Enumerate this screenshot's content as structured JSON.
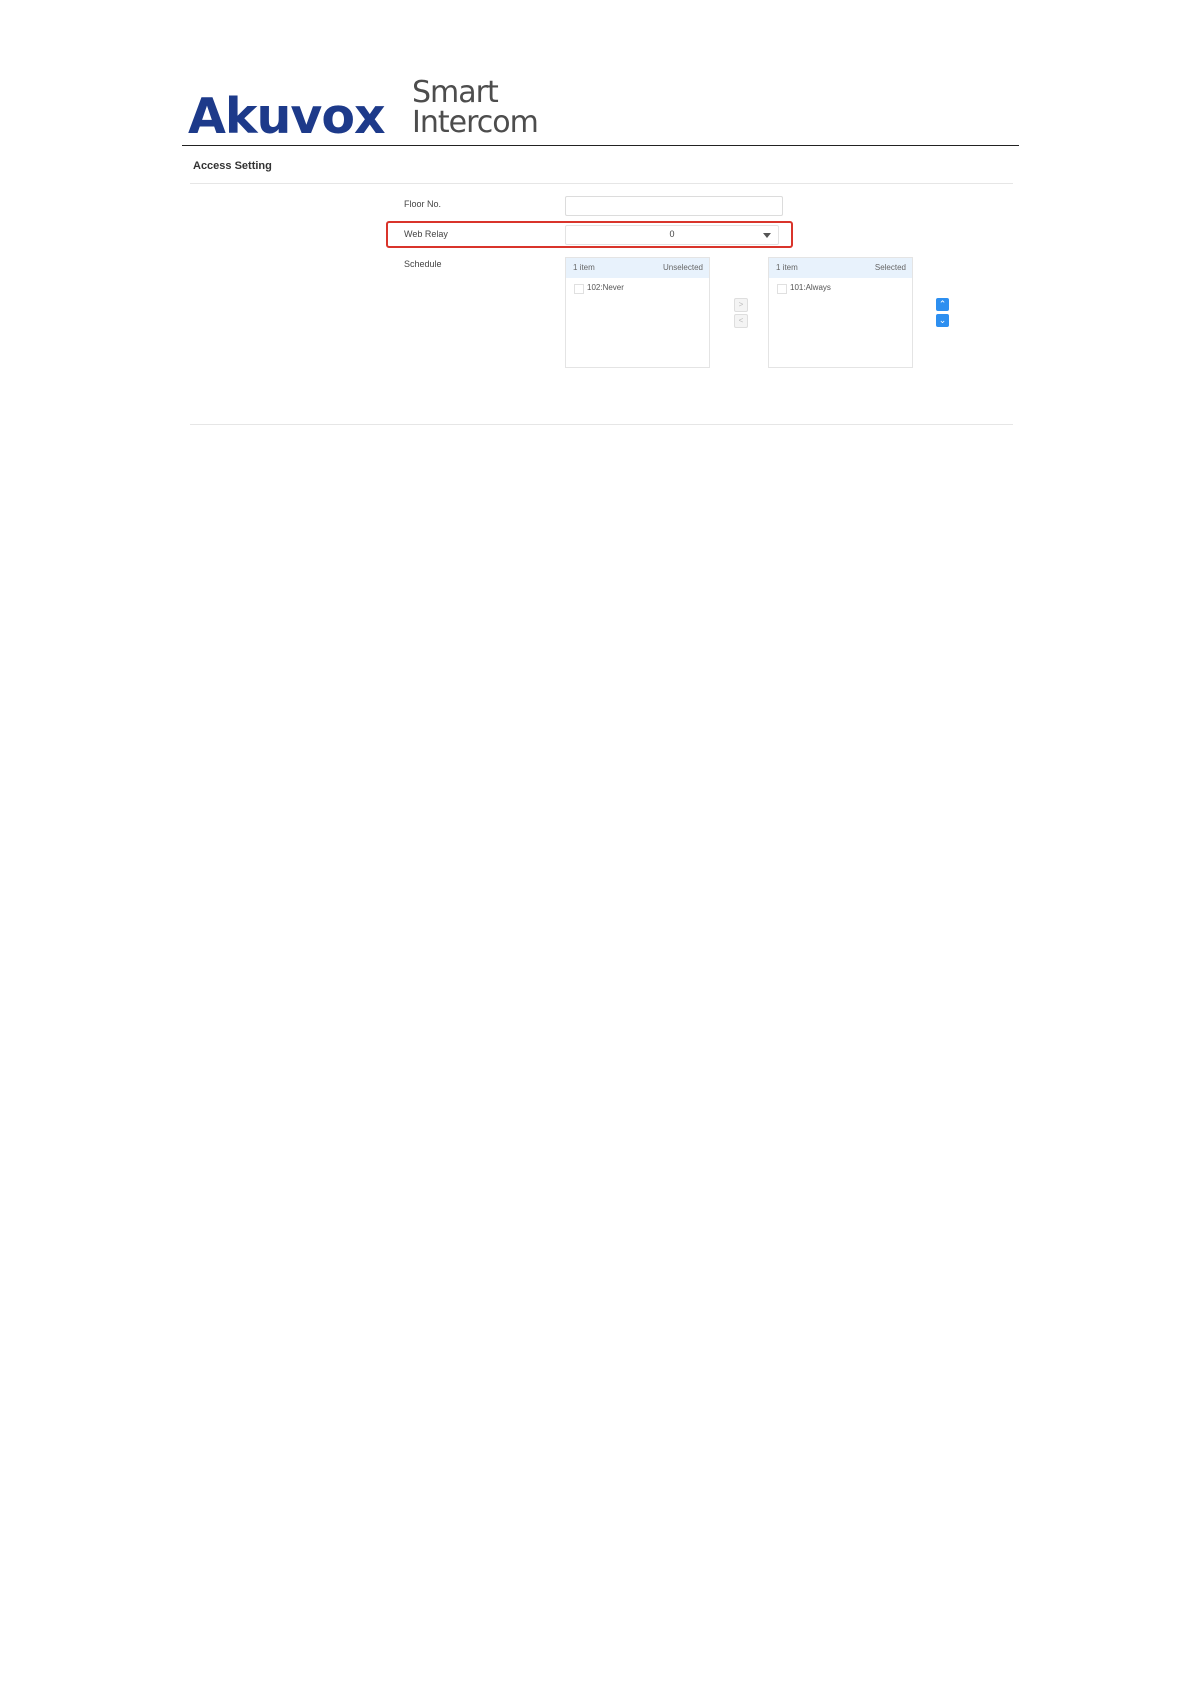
{
  "header": {
    "brand": "Akuvox",
    "tagline_line1": "Smart",
    "tagline_line2": "Intercom",
    "brand_color": "#1d3a8a"
  },
  "section": {
    "title": "Access Setting"
  },
  "form": {
    "floor_label": "Floor No.",
    "floor_value": "",
    "relay_label": "Web Relay",
    "relay_value": "0",
    "schedule_label": "Schedule"
  },
  "schedule": {
    "unselected": {
      "count": "1 item",
      "title": "Unselected",
      "items": [
        {
          "label": "102:Never"
        }
      ]
    },
    "selected": {
      "count": "1 item",
      "title": "Selected",
      "items": [
        {
          "label": "101:Always"
        }
      ]
    },
    "transfer_right_icon": "chevron-right-icon",
    "transfer_left_icon": "chevron-left-icon",
    "move_up_icon": "chevron-up-icon",
    "move_down_icon": "chevron-down-icon",
    "accent_color": "#2d8ff0",
    "highlight_color": "#d9342b"
  }
}
